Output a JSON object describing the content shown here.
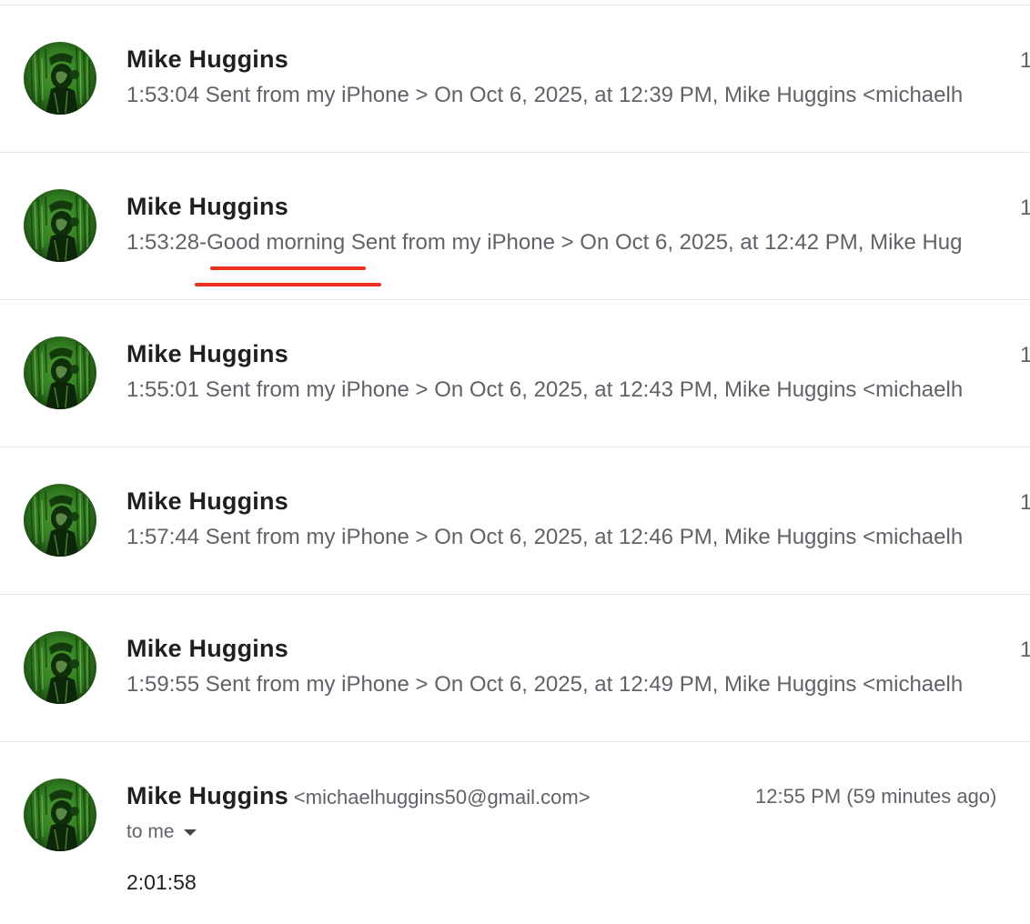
{
  "thread": {
    "messages": [
      {
        "sender": "Mike Huggins",
        "date_cut": "1",
        "snippet": "1:53:04 Sent from my iPhone > On Oct 6, 2025, at 12:39 PM, Mike Huggins <michaelh"
      },
      {
        "sender": "Mike Huggins",
        "date_cut": "1",
        "snippet_prefix": "1:53:28-",
        "snippet_highlight": "Good morning",
        "snippet_rest": " Sent from my iPhone > On Oct 6, 2025, at 12:42 PM, Mike Hug"
      },
      {
        "sender": "Mike Huggins",
        "date_cut": "1",
        "snippet": "1:55:01 Sent from my iPhone > On Oct 6, 2025, at 12:43 PM, Mike Huggins <michaelh"
      },
      {
        "sender": "Mike Huggins",
        "date_cut": "1",
        "snippet": "1:57:44 Sent from my iPhone > On Oct 6, 2025, at 12:46 PM, Mike Huggins <michaelh"
      },
      {
        "sender": "Mike Huggins",
        "date_cut": "1",
        "snippet": "1:59:55 Sent from my iPhone > On Oct 6, 2025, at 12:49 PM, Mike Huggins <michaelh"
      }
    ],
    "expanded": {
      "sender": "Mike Huggins",
      "email": "<michaelhuggins50@gmail.com>",
      "time": "12:55 PM (59 minutes ago)",
      "recipient": "to me",
      "body": "2:01:58"
    }
  },
  "colors": {
    "annotation_underline": "#e8321d",
    "avatar_green": "#2f7a1f"
  },
  "icons": {
    "avatar": "avatar-photo",
    "recipient_toggle": "caret-down-icon"
  }
}
